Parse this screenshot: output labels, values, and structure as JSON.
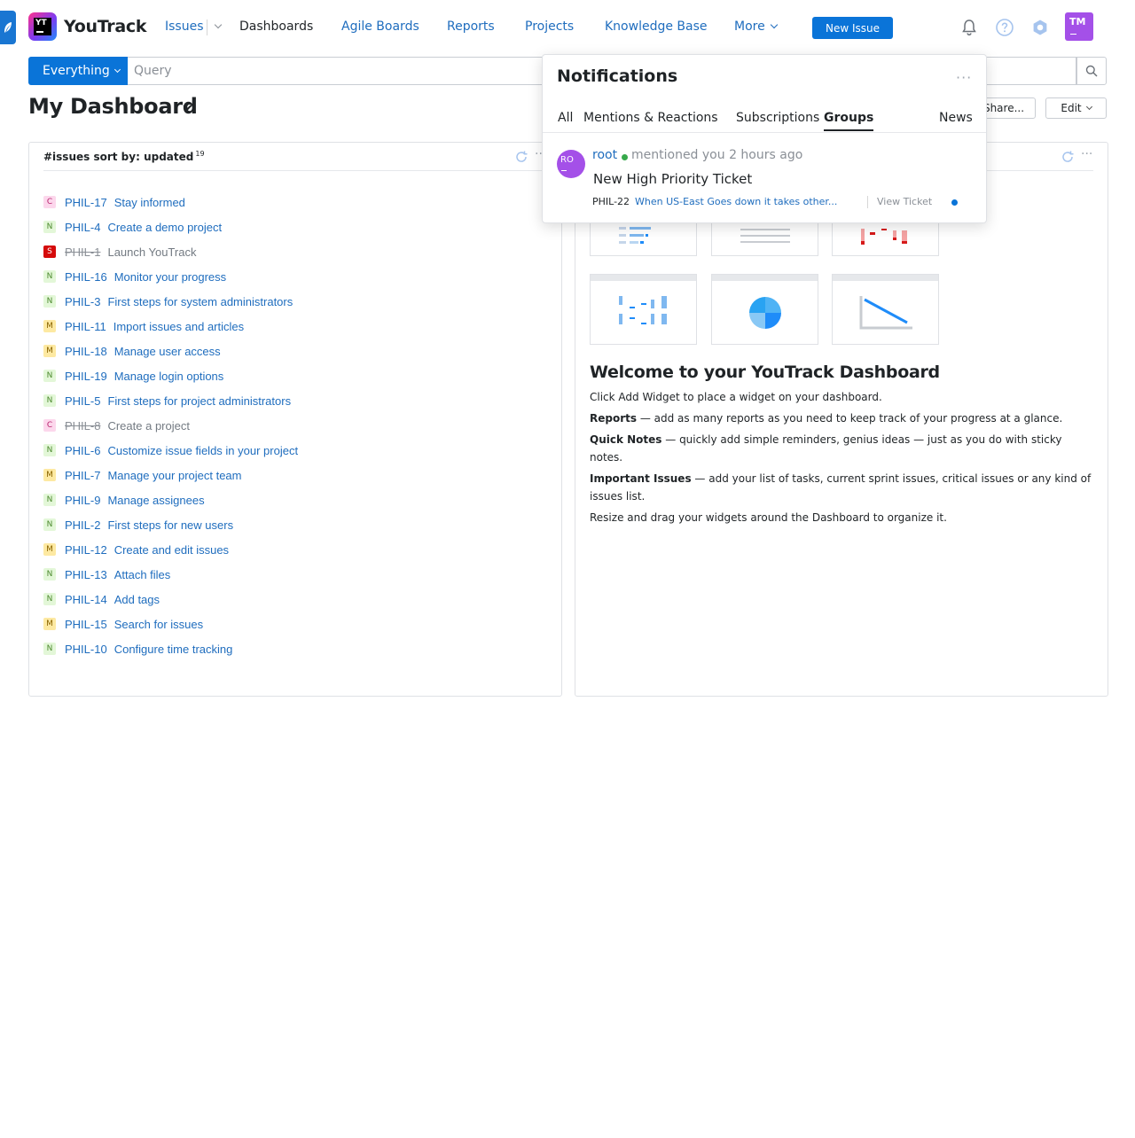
{
  "app": {
    "name": "YouTrack",
    "logo_text": "YT"
  },
  "nav": {
    "issues": "Issues",
    "dashboards": "Dashboards",
    "agile_boards": "Agile Boards",
    "reports": "Reports",
    "projects": "Projects",
    "knowledge_base": "Knowledge Base",
    "more": "More",
    "new_issue": "New Issue"
  },
  "user": {
    "initials": "TM"
  },
  "search": {
    "context": "Everything",
    "placeholder": "Query"
  },
  "dashboard": {
    "title": "My Dashboard",
    "share_label": "Share...",
    "edit_label": "Edit"
  },
  "issues_widget": {
    "title": "#issues sort by: updated",
    "count": "19",
    "issues": [
      {
        "badge": "C",
        "id": "PHIL-17",
        "summary": "Stay informed",
        "resolved": false
      },
      {
        "badge": "N",
        "id": "PHIL-4",
        "summary": "Create a demo project",
        "resolved": false
      },
      {
        "badge": "S",
        "id": "PHIL-1",
        "summary": "Launch YouTrack",
        "resolved": true
      },
      {
        "badge": "N",
        "id": "PHIL-16",
        "summary": "Monitor your progress",
        "resolved": false
      },
      {
        "badge": "N",
        "id": "PHIL-3",
        "summary": "First steps for system administrators",
        "resolved": false
      },
      {
        "badge": "M",
        "id": "PHIL-11",
        "summary": "Import issues and articles",
        "resolved": false
      },
      {
        "badge": "M",
        "id": "PHIL-18",
        "summary": "Manage user access",
        "resolved": false
      },
      {
        "badge": "N",
        "id": "PHIL-19",
        "summary": "Manage login options",
        "resolved": false
      },
      {
        "badge": "N",
        "id": "PHIL-5",
        "summary": "First steps for project administrators",
        "resolved": false
      },
      {
        "badge": "C",
        "id": "PHIL-8",
        "summary": "Create a project",
        "resolved": true
      },
      {
        "badge": "N",
        "id": "PHIL-6",
        "summary": "Customize issue fields in your project",
        "resolved": false
      },
      {
        "badge": "M",
        "id": "PHIL-7",
        "summary": "Manage your project team",
        "resolved": false
      },
      {
        "badge": "N",
        "id": "PHIL-9",
        "summary": "Manage assignees",
        "resolved": false
      },
      {
        "badge": "N",
        "id": "PHIL-2",
        "summary": "First steps for new users",
        "resolved": false
      },
      {
        "badge": "M",
        "id": "PHIL-12",
        "summary": "Create and edit issues",
        "resolved": false
      },
      {
        "badge": "N",
        "id": "PHIL-13",
        "summary": "Attach files",
        "resolved": false
      },
      {
        "badge": "N",
        "id": "PHIL-14",
        "summary": "Add tags",
        "resolved": false
      },
      {
        "badge": "M",
        "id": "PHIL-15",
        "summary": "Search for issues",
        "resolved": false
      },
      {
        "badge": "N",
        "id": "PHIL-10",
        "summary": "Configure time tracking",
        "resolved": false
      }
    ]
  },
  "welcome_widget": {
    "title": "Welcome to your YouTrack Dashboard",
    "intro": "Click Add Widget to place a widget on your dashboard.",
    "reports_label": "Reports",
    "reports_text": " — add as many reports as you need to keep track of your progress at a glance.",
    "notes_label": "Quick Notes",
    "notes_text": " — quickly add simple reminders, genius ideas — just as you do with sticky notes.",
    "important_label": "Important Issues",
    "important_text": " — add your list of tasks, current sprint issues, critical issues or any kind of issues list.",
    "outro": "Resize and drag your widgets around the Dashboard to organize it."
  },
  "notifications": {
    "title": "Notifications",
    "tabs": [
      "All",
      "Mentions & Reactions",
      "Subscriptions",
      "Groups",
      "News"
    ],
    "active_tab": "Groups",
    "items": [
      {
        "avatar": "RO",
        "user": "root",
        "action": "mentioned you 2 hours ago",
        "headline": "New High Priority Ticket",
        "issue_id": "PHIL-22",
        "issue_summary": "When US-East Goes down it takes other...",
        "view_label": "View Ticket"
      }
    ]
  },
  "colors": {
    "accent": "#0a74d8",
    "link": "#1f6dbe",
    "avatar": "#a450e8",
    "badge_normal": "#e3f7d8",
    "badge_critical": "#fcd7ec",
    "badge_major": "#fde9a2",
    "badge_showstopper": "#d50b0b"
  }
}
